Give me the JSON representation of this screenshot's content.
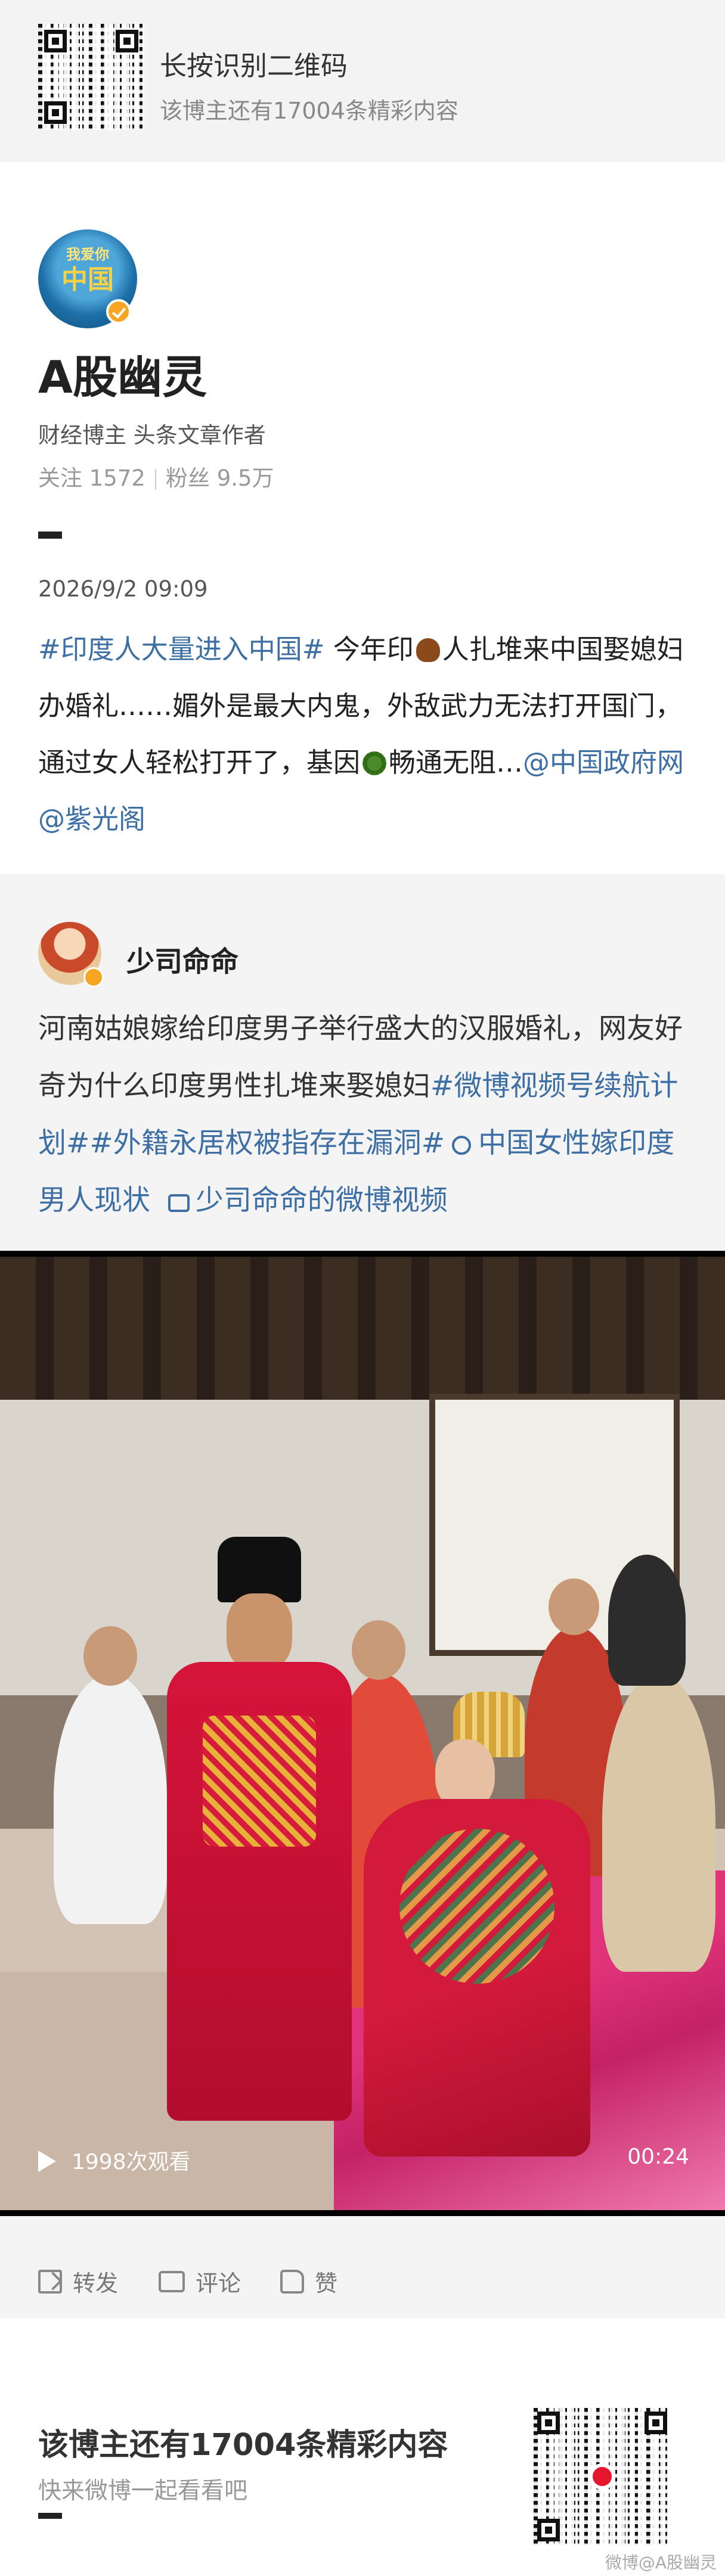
{
  "top_banner": {
    "title": "长按识别二维码",
    "subtitle": "该博主还有17004条精彩内容"
  },
  "author": {
    "avatar_text_top": "我爱你",
    "avatar_text": "中国",
    "name": "A股幽灵",
    "description": "财经博主 头条文章作者",
    "follow": "关注 1572",
    "fans": "粉丝 9.5万"
  },
  "post": {
    "time": "2026/9/2 09:09",
    "tag_1": "#印度人大量进入中国#",
    "text_1": " 今年印",
    "text_2": "人扎堆来中国娶媳妇办婚礼……媚外是最大内鬼，外敌武力无法打开国门，通过女人轻松打开了，基因",
    "text_3": "畅通无阻…",
    "mention_1": "@中国政府网",
    "mention_2": " @紫光阁",
    "emoji_1": "poop-emoji",
    "emoji_2": "virus-emoji"
  },
  "repost": {
    "name": "少司命命",
    "text": "河南姑娘嫁给印度男子举行盛大的汉服婚礼，网友好奇为什么印度男性扎堆来娶媳妇",
    "tag_1": "#微博视频号续航计划#",
    "tag_2": "#外籍永居权被指存在漏洞#",
    "link_1": "中国女性嫁印度男人现状",
    "link_2": "少司命命的微博视频",
    "video": {
      "views": "1998次观看",
      "duration": "00:24"
    }
  },
  "actions": {
    "repost": "转发",
    "comment": "评论",
    "like": "赞"
  },
  "bottom": {
    "title": "该博主还有17004条精彩内容",
    "subtitle": "快来微博一起看看吧",
    "watermark": "微博@A股幽灵"
  },
  "colors": {
    "link": "#3d6fa5",
    "verified": "#f6a623",
    "weibo_red": "#e6162d"
  }
}
